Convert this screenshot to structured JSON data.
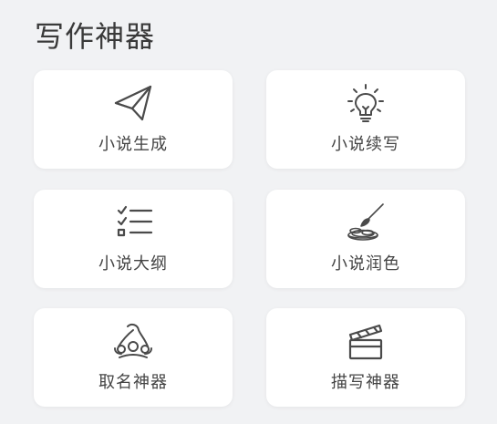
{
  "page": {
    "title": "写作神器"
  },
  "cards": [
    {
      "label": "小说生成",
      "icon": "paper-plane-icon"
    },
    {
      "label": "小说续写",
      "icon": "lightbulb-icon"
    },
    {
      "label": "小说大纲",
      "icon": "checklist-icon"
    },
    {
      "label": "小说润色",
      "icon": "brush-palette-icon"
    },
    {
      "label": "取名神器",
      "icon": "crown-icon"
    },
    {
      "label": "描写神器",
      "icon": "clapperboard-icon"
    }
  ],
  "colors": {
    "background": "#f1f2f4",
    "card": "#ffffff",
    "text": "#444444",
    "icon": "#4a4a4a"
  }
}
